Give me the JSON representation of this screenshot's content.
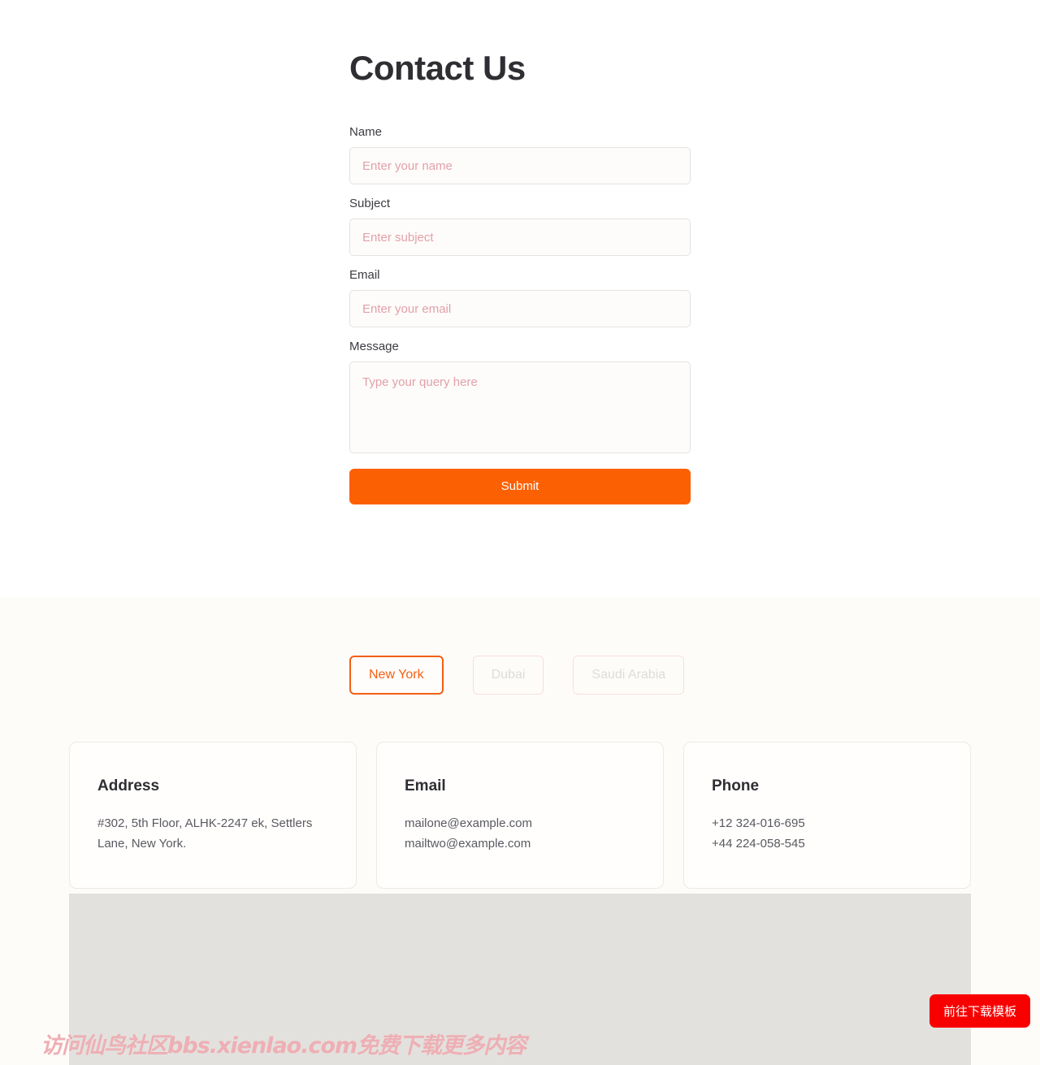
{
  "page": {
    "title": "Contact Us"
  },
  "form": {
    "fields": [
      {
        "label": "Name",
        "placeholder": "Enter your name",
        "value": "",
        "type": "text"
      },
      {
        "label": "Subject",
        "placeholder": "Enter subject",
        "value": "",
        "type": "text"
      },
      {
        "label": "Email",
        "placeholder": "Enter your email",
        "value": "",
        "type": "text"
      }
    ],
    "message": {
      "label": "Message",
      "placeholder": "Type your query here",
      "value": ""
    },
    "submit_label": "Submit"
  },
  "locations": {
    "tabs": [
      {
        "label": "New York",
        "active": true
      },
      {
        "label": "Dubai",
        "active": false
      },
      {
        "label": "Saudi Arabia",
        "active": false
      }
    ]
  },
  "cards": [
    {
      "title": "Address",
      "lines": [
        "#302, 5th Floor, ALHK-2247 ek, Settlers Lane, New York."
      ]
    },
    {
      "title": "Email",
      "lines": [
        "mailone@example.com",
        "mailtwo@example.com"
      ]
    },
    {
      "title": "Phone",
      "lines": [
        "+12 324-016-695",
        "+44 224-058-545"
      ]
    }
  ],
  "overlay": {
    "watermark": "访问仙鸟社区bbs.xienlao.com免费下载更多内容",
    "download_button": "前往下载模板"
  },
  "colors": {
    "accent_orange": "#fb6003",
    "tab_active_border": "#f26013",
    "placeholder_pink": "#e2a0a8",
    "watermark_pink": "#eeafb4",
    "download_red": "#f90000",
    "map_gray": "#e3e1de",
    "section_cream": "#fefcf9"
  }
}
